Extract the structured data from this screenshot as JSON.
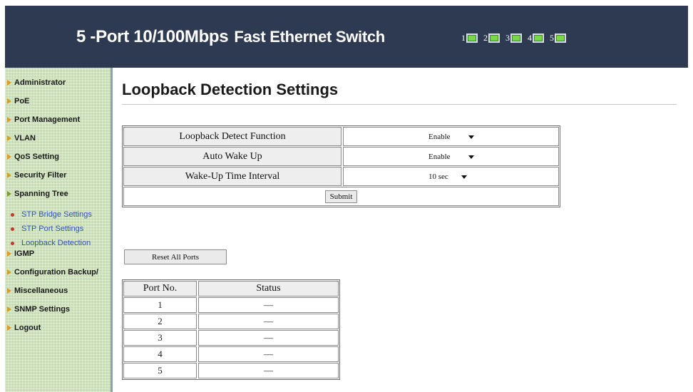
{
  "header": {
    "title_part1": "5 -Port 10/100Mbps",
    "title_part2": "Fast Ethernet Switch",
    "ports": [
      "1",
      "2",
      "3",
      "4",
      "5"
    ],
    "port_led_color": "#7bd64a"
  },
  "sidebar": {
    "items": [
      {
        "label": "Administrator"
      },
      {
        "label": "PoE"
      },
      {
        "label": "Port Management"
      },
      {
        "label": "VLAN"
      },
      {
        "label": "QoS Setting"
      },
      {
        "label": "Security Filter"
      },
      {
        "label": "Spanning Tree"
      },
      {
        "label": "IGMP"
      },
      {
        "label": "Configuration Backup/"
      },
      {
        "label": "Miscellaneous"
      },
      {
        "label": "SNMP Settings"
      },
      {
        "label": "Logout"
      }
    ],
    "subitems": [
      {
        "label": "STP Bridge Settings"
      },
      {
        "label": "STP Port Settings"
      },
      {
        "label": "Loopback Detection"
      }
    ]
  },
  "main": {
    "title": "Loopback Detection Settings",
    "settings": [
      {
        "label": "Loopback Detect Function",
        "value": "Enable"
      },
      {
        "label": "Auto Wake Up",
        "value": "Enable"
      },
      {
        "label": "Wake-Up Time Interval",
        "value": "10 sec"
      }
    ],
    "submit_label": "Submit",
    "reset_label": "Reset All Ports",
    "table": {
      "headers": [
        "Port No.",
        "Status"
      ],
      "rows": [
        {
          "port": "1",
          "status": "—"
        },
        {
          "port": "2",
          "status": "—"
        },
        {
          "port": "3",
          "status": "—"
        },
        {
          "port": "4",
          "status": "—"
        },
        {
          "port": "5",
          "status": "—"
        }
      ]
    }
  }
}
